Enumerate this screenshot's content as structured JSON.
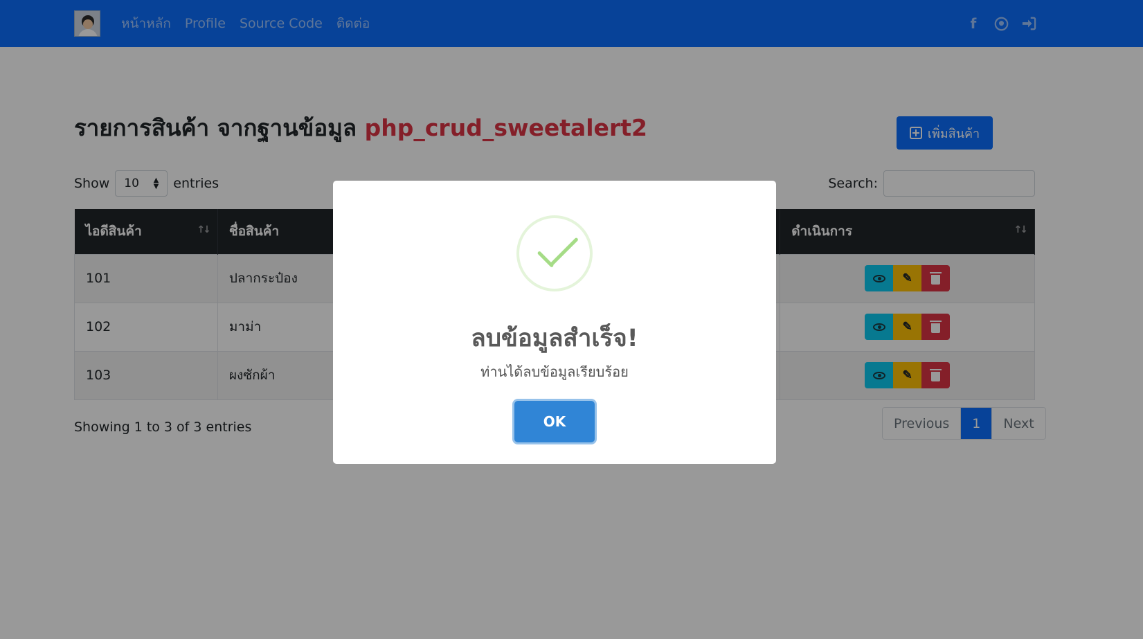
{
  "navbar": {
    "links": [
      {
        "label": "หน้าหลัก"
      },
      {
        "label": "Profile"
      },
      {
        "label": "Source Code"
      },
      {
        "label": "ติดต่อ"
      }
    ],
    "icons": [
      "facebook-icon",
      "github-icon",
      "sign-in-icon"
    ]
  },
  "page": {
    "title_prefix": "รายการสินค้า จากฐานข้อมูล",
    "title_db": "php_crud_sweetalert2",
    "add_button_label": "เพิ่มสินค้า"
  },
  "table_controls": {
    "show_label": "Show",
    "page_length": "10",
    "entries_label": "entries",
    "search_label": "Search:",
    "search_value": ""
  },
  "table": {
    "headers": [
      "ไอดีสินค้า",
      "ชื่อสินค้า",
      "",
      "ดำเนินการ"
    ],
    "rows": [
      {
        "id": "101",
        "name": "ปลากระป๋อง"
      },
      {
        "id": "102",
        "name": "มาม่า"
      },
      {
        "id": "103",
        "name": "ผงซักผ้า"
      }
    ]
  },
  "footer": {
    "info": "Showing 1 to 3 of 3 entries",
    "prev_label": "Previous",
    "current_page": "1",
    "next_label": "Next"
  },
  "modal": {
    "icon": "success-check-icon",
    "title": "ลบข้อมูลสำเร็จ!",
    "text": "ท่านได้ลบข้อมูลเรียบร้อย",
    "confirm_label": "OK",
    "confirm_color": "#3085d6"
  },
  "colors": {
    "primary": "#0d6efd",
    "danger": "#dc3545",
    "warning": "#ffc107",
    "info": "#0dcaf0",
    "success": "#a5dc86"
  }
}
